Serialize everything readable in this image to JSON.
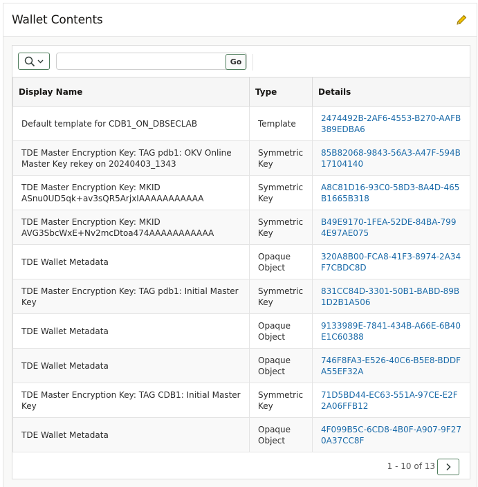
{
  "region": {
    "title": "Wallet Contents"
  },
  "toolbar": {
    "search_value": "",
    "go_label": "Go"
  },
  "table": {
    "headers": {
      "display_name": "Display Name",
      "type": "Type",
      "details": "Details"
    },
    "rows": [
      {
        "display_name": "Default template for CDB1_ON_DBSECLAB",
        "type": "Template",
        "details": "2474492B-2AF6-4553-B270-AAFB389EDBA6"
      },
      {
        "display_name": "TDE Master Encryption Key: TAG pdb1: OKV Online Master Key rekey on 20240403_1343",
        "type": "Symmetric Key",
        "details": "85B82068-9843-56A3-A47F-594B17104140"
      },
      {
        "display_name": "TDE Master Encryption Key: MKID ASnu0UD5qk+av3sQR5ArjxIAAAAAAAAAAA",
        "type": "Symmetric Key",
        "details": "A8C81D16-93C0-58D3-8A4D-465B1665B318"
      },
      {
        "display_name": "TDE Master Encryption Key: MKID AVG3SbcWxE+Nv2mcDtoa474AAAAAAAAAAA",
        "type": "Symmetric Key",
        "details": "B49E9170-1FEA-52DE-84BA-7994E97AE075"
      },
      {
        "display_name": "TDE Wallet Metadata",
        "type": "Opaque Object",
        "details": "320A8B00-FCA8-41F3-8974-2A34F7CBDC8D"
      },
      {
        "display_name": "TDE Master Encryption Key: TAG pdb1: Initial Master Key",
        "type": "Symmetric Key",
        "details": "831CC84D-3301-50B1-BABD-89B1D2B1A506"
      },
      {
        "display_name": "TDE Wallet Metadata",
        "type": "Opaque Object",
        "details": "9133989E-7841-434B-A66E-6B40E1C60388"
      },
      {
        "display_name": "TDE Wallet Metadata",
        "type": "Opaque Object",
        "details": "746F8FA3-E526-40C6-B5E8-BDDFA55EF32A"
      },
      {
        "display_name": "TDE Master Encryption Key: TAG CDB1: Initial Master Key",
        "type": "Symmetric Key",
        "details": "71D5BD44-EC63-551A-97CE-E2F2A06FFB12"
      },
      {
        "display_name": "TDE Wallet Metadata",
        "type": "Opaque Object",
        "details": "4F099B5C-6CD8-4B0F-A907-9F270A37CC8F"
      }
    ]
  },
  "pagination": {
    "text": "1 - 10 of 13"
  },
  "icons": {
    "edit": "pencil-icon",
    "search": "search-icon",
    "dropdown": "chevron-down-icon",
    "next": "chevron-right-icon"
  },
  "colors": {
    "link": "#1b6ba9",
    "button_border": "#4f7d5c",
    "pencil": "#e8b500"
  }
}
